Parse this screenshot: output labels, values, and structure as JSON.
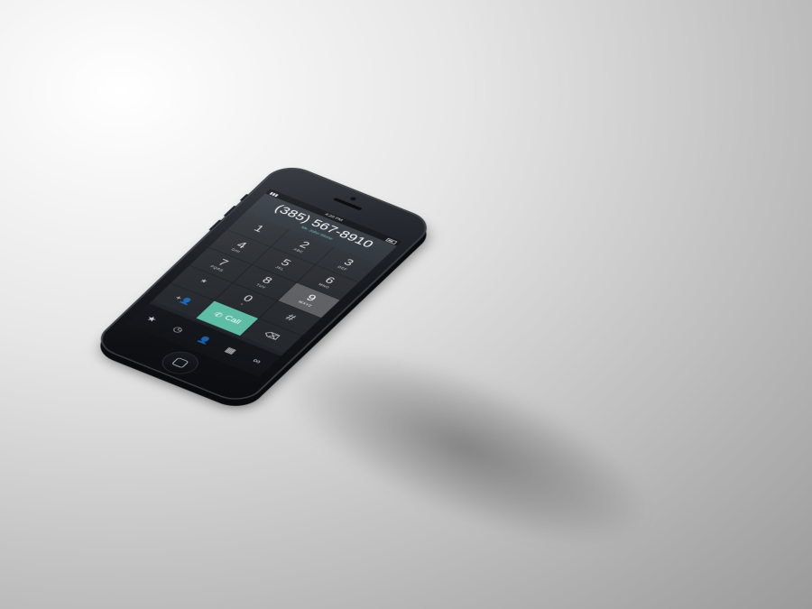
{
  "status": {
    "time": "4:20 PM",
    "signal": "▮▮▮"
  },
  "display": {
    "number": "(385) 567-8910",
    "contact": "Mr. John Stone"
  },
  "keypad": [
    {
      "digit": "1",
      "letters": ""
    },
    {
      "digit": "2",
      "letters": "ABC"
    },
    {
      "digit": "3",
      "letters": "DEF"
    },
    {
      "digit": "4",
      "letters": "GHI"
    },
    {
      "digit": "5",
      "letters": "JKL"
    },
    {
      "digit": "6",
      "letters": "MNO"
    },
    {
      "digit": "7",
      "letters": "PQRS"
    },
    {
      "digit": "8",
      "letters": "TUV"
    },
    {
      "digit": "9",
      "letters": "WXYZ"
    },
    {
      "digit": "*",
      "letters": ""
    },
    {
      "digit": "0",
      "letters": "+"
    },
    {
      "digit": "#",
      "letters": ""
    }
  ],
  "actions": {
    "add": "+👤",
    "call": "Call",
    "call_icon": "✆",
    "delete": "⌫"
  },
  "tabs": [
    {
      "icon": "★",
      "name": "favorites"
    },
    {
      "icon": "◷",
      "name": "recents"
    },
    {
      "icon": "👤",
      "name": "contacts"
    },
    {
      "icon": "▦",
      "name": "keypad"
    },
    {
      "icon": "∞",
      "name": "voicemail"
    }
  ],
  "colors": {
    "accent": "#5fbda6",
    "contact_text": "#6fd6b9"
  }
}
